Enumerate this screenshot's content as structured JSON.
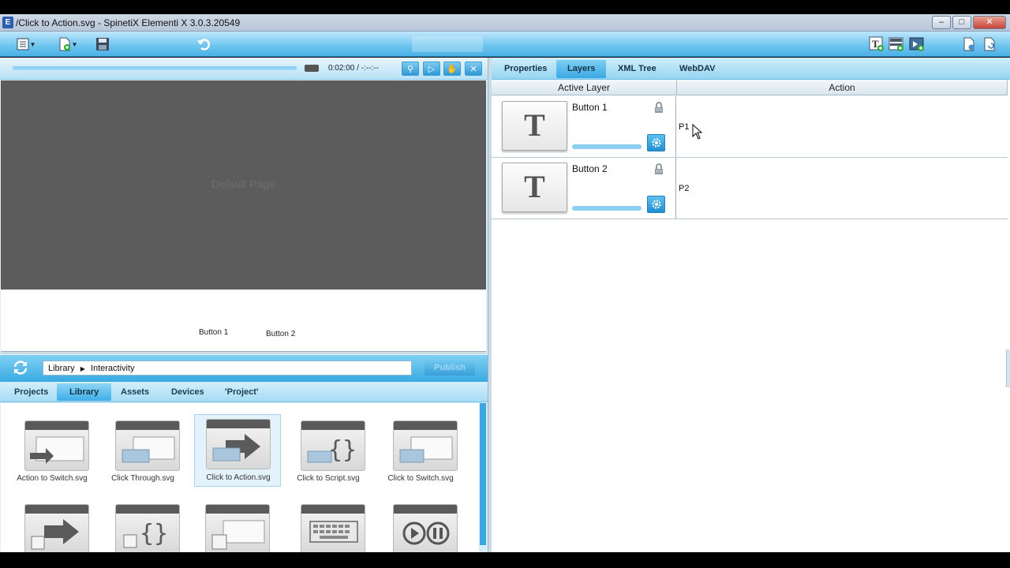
{
  "window": {
    "title": "/Click to Action.svg - SpinetiX Elementi X 3.0.3.20549",
    "app_icon": "E"
  },
  "timeline": {
    "time": "0:02:00 / -:--:--"
  },
  "stage": {
    "page_label": "Default Page",
    "button1": "Button 1",
    "button2": "Button 2"
  },
  "library": {
    "path_root": "Library",
    "path_child": "Interactivity",
    "publish": "Publish",
    "tabs": [
      {
        "label": "Projects"
      },
      {
        "label": "Library"
      },
      {
        "label": "Assets"
      },
      {
        "label": "Devices"
      },
      {
        "label": "'Project'"
      }
    ],
    "items": [
      {
        "label": "Action to Switch.svg"
      },
      {
        "label": "Click Through.svg"
      },
      {
        "label": "Click to Action.svg"
      },
      {
        "label": "Click to Script.svg"
      },
      {
        "label": "Click to Switch.svg"
      }
    ]
  },
  "right": {
    "tabs": [
      {
        "label": "Properties"
      },
      {
        "label": "Layers"
      },
      {
        "label": "XML Tree"
      },
      {
        "label": "WebDAV"
      }
    ],
    "columns": {
      "active_layer": "Active Layer",
      "action": "Action"
    },
    "layers": [
      {
        "thumb": "T",
        "name": "Button 1",
        "action": "P1"
      },
      {
        "thumb": "T",
        "name": "Button 2",
        "action": "P2"
      }
    ]
  },
  "colors": {
    "accent": "#3aa9e2",
    "stage": "#5c5c5c"
  }
}
